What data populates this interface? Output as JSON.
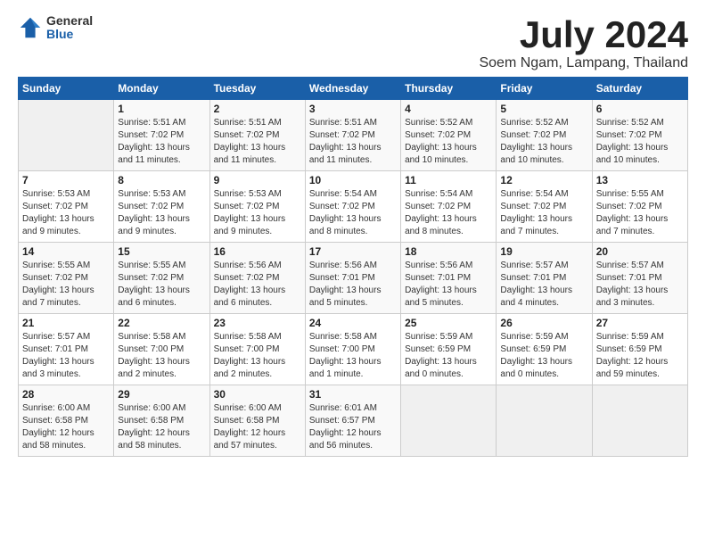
{
  "logo": {
    "general": "General",
    "blue": "Blue"
  },
  "title": "July 2024",
  "subtitle": "Soem Ngam, Lampang, Thailand",
  "header": {
    "days": [
      "Sunday",
      "Monday",
      "Tuesday",
      "Wednesday",
      "Thursday",
      "Friday",
      "Saturday"
    ]
  },
  "weeks": [
    [
      {
        "day": "",
        "info": ""
      },
      {
        "day": "1",
        "info": "Sunrise: 5:51 AM\nSunset: 7:02 PM\nDaylight: 13 hours\nand 11 minutes."
      },
      {
        "day": "2",
        "info": "Sunrise: 5:51 AM\nSunset: 7:02 PM\nDaylight: 13 hours\nand 11 minutes."
      },
      {
        "day": "3",
        "info": "Sunrise: 5:51 AM\nSunset: 7:02 PM\nDaylight: 13 hours\nand 11 minutes."
      },
      {
        "day": "4",
        "info": "Sunrise: 5:52 AM\nSunset: 7:02 PM\nDaylight: 13 hours\nand 10 minutes."
      },
      {
        "day": "5",
        "info": "Sunrise: 5:52 AM\nSunset: 7:02 PM\nDaylight: 13 hours\nand 10 minutes."
      },
      {
        "day": "6",
        "info": "Sunrise: 5:52 AM\nSunset: 7:02 PM\nDaylight: 13 hours\nand 10 minutes."
      }
    ],
    [
      {
        "day": "7",
        "info": "Sunrise: 5:53 AM\nSunset: 7:02 PM\nDaylight: 13 hours\nand 9 minutes."
      },
      {
        "day": "8",
        "info": "Sunrise: 5:53 AM\nSunset: 7:02 PM\nDaylight: 13 hours\nand 9 minutes."
      },
      {
        "day": "9",
        "info": "Sunrise: 5:53 AM\nSunset: 7:02 PM\nDaylight: 13 hours\nand 9 minutes."
      },
      {
        "day": "10",
        "info": "Sunrise: 5:54 AM\nSunset: 7:02 PM\nDaylight: 13 hours\nand 8 minutes."
      },
      {
        "day": "11",
        "info": "Sunrise: 5:54 AM\nSunset: 7:02 PM\nDaylight: 13 hours\nand 8 minutes."
      },
      {
        "day": "12",
        "info": "Sunrise: 5:54 AM\nSunset: 7:02 PM\nDaylight: 13 hours\nand 7 minutes."
      },
      {
        "day": "13",
        "info": "Sunrise: 5:55 AM\nSunset: 7:02 PM\nDaylight: 13 hours\nand 7 minutes."
      }
    ],
    [
      {
        "day": "14",
        "info": "Sunrise: 5:55 AM\nSunset: 7:02 PM\nDaylight: 13 hours\nand 7 minutes."
      },
      {
        "day": "15",
        "info": "Sunrise: 5:55 AM\nSunset: 7:02 PM\nDaylight: 13 hours\nand 6 minutes."
      },
      {
        "day": "16",
        "info": "Sunrise: 5:56 AM\nSunset: 7:02 PM\nDaylight: 13 hours\nand 6 minutes."
      },
      {
        "day": "17",
        "info": "Sunrise: 5:56 AM\nSunset: 7:01 PM\nDaylight: 13 hours\nand 5 minutes."
      },
      {
        "day": "18",
        "info": "Sunrise: 5:56 AM\nSunset: 7:01 PM\nDaylight: 13 hours\nand 5 minutes."
      },
      {
        "day": "19",
        "info": "Sunrise: 5:57 AM\nSunset: 7:01 PM\nDaylight: 13 hours\nand 4 minutes."
      },
      {
        "day": "20",
        "info": "Sunrise: 5:57 AM\nSunset: 7:01 PM\nDaylight: 13 hours\nand 3 minutes."
      }
    ],
    [
      {
        "day": "21",
        "info": "Sunrise: 5:57 AM\nSunset: 7:01 PM\nDaylight: 13 hours\nand 3 minutes."
      },
      {
        "day": "22",
        "info": "Sunrise: 5:58 AM\nSunset: 7:00 PM\nDaylight: 13 hours\nand 2 minutes."
      },
      {
        "day": "23",
        "info": "Sunrise: 5:58 AM\nSunset: 7:00 PM\nDaylight: 13 hours\nand 2 minutes."
      },
      {
        "day": "24",
        "info": "Sunrise: 5:58 AM\nSunset: 7:00 PM\nDaylight: 13 hours\nand 1 minute."
      },
      {
        "day": "25",
        "info": "Sunrise: 5:59 AM\nSunset: 6:59 PM\nDaylight: 13 hours\nand 0 minutes."
      },
      {
        "day": "26",
        "info": "Sunrise: 5:59 AM\nSunset: 6:59 PM\nDaylight: 13 hours\nand 0 minutes."
      },
      {
        "day": "27",
        "info": "Sunrise: 5:59 AM\nSunset: 6:59 PM\nDaylight: 12 hours\nand 59 minutes."
      }
    ],
    [
      {
        "day": "28",
        "info": "Sunrise: 6:00 AM\nSunset: 6:58 PM\nDaylight: 12 hours\nand 58 minutes."
      },
      {
        "day": "29",
        "info": "Sunrise: 6:00 AM\nSunset: 6:58 PM\nDaylight: 12 hours\nand 58 minutes."
      },
      {
        "day": "30",
        "info": "Sunrise: 6:00 AM\nSunset: 6:58 PM\nDaylight: 12 hours\nand 57 minutes."
      },
      {
        "day": "31",
        "info": "Sunrise: 6:01 AM\nSunset: 6:57 PM\nDaylight: 12 hours\nand 56 minutes."
      },
      {
        "day": "",
        "info": ""
      },
      {
        "day": "",
        "info": ""
      },
      {
        "day": "",
        "info": ""
      }
    ]
  ]
}
